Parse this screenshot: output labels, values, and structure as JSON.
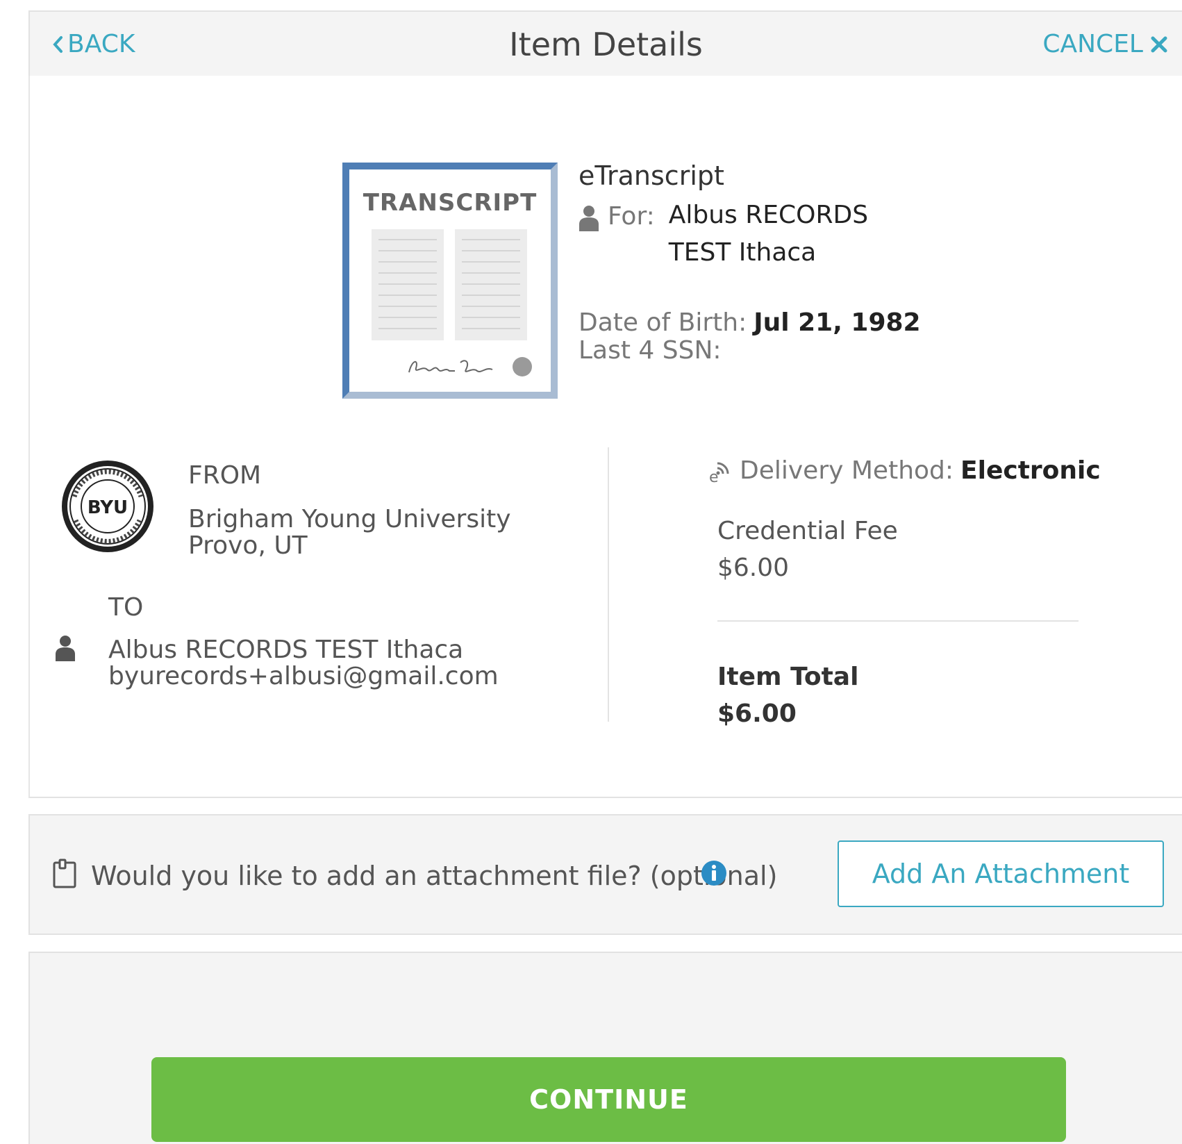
{
  "header": {
    "back_label": "BACK",
    "title": "Item Details",
    "cancel_label": "CANCEL"
  },
  "item": {
    "image_label": "TRANSCRIPT",
    "type": "eTranscript",
    "for_label": "For:",
    "for_name": "Albus RECORDS TEST Ithaca",
    "dob_label": "Date of Birth:",
    "dob_value": "Jul 21, 1982",
    "ssn_label": "Last 4 SSN:"
  },
  "from": {
    "label": "FROM",
    "name": "Brigham Young University",
    "location": "Provo, UT",
    "seal_text": "BYU"
  },
  "to": {
    "label": "TO",
    "name": "Albus RECORDS TEST Ithaca",
    "email": "byurecords+albusi@gmail.com"
  },
  "delivery": {
    "label": "Delivery Method:",
    "value": "Electronic"
  },
  "fees": {
    "credential_fee_label": "Credential Fee",
    "credential_fee_value": "$6.00",
    "item_total_label": "Item Total",
    "item_total_value": "$6.00"
  },
  "attachment": {
    "prompt": "Would you like to add an attachment file? (optional)",
    "button_label": "Add An Attachment"
  },
  "footer": {
    "continue_label": "CONTINUE"
  },
  "colors": {
    "accent": "#3aa8c1",
    "continue_green": "#6cbd45",
    "info_blue": "#2b8cc4"
  },
  "icons": {
    "back": "chevron-left-icon",
    "cancel": "close-icon",
    "person": "person-icon",
    "delivery": "electronic-delivery-icon",
    "attachment": "clipboard-icon",
    "info": "info-icon"
  }
}
